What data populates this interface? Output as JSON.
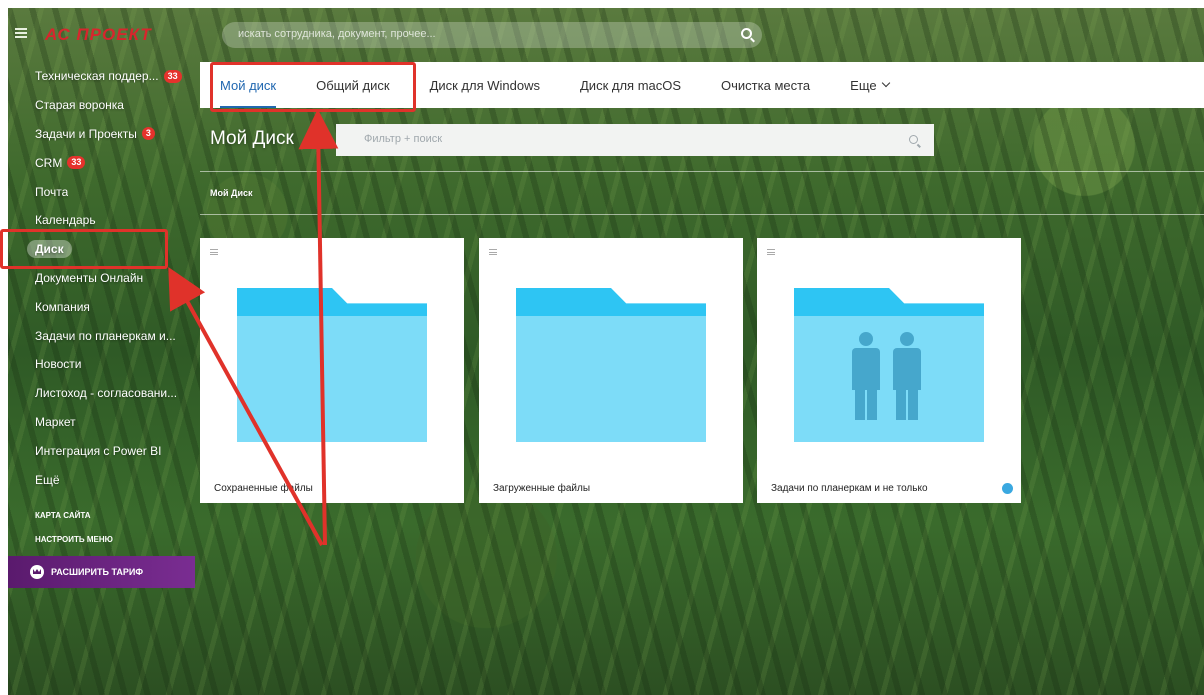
{
  "header": {
    "logo_text": "АС ПРОЕКТ",
    "search_placeholder": "искать сотрудника, документ, прочее..."
  },
  "sidebar": {
    "items": [
      {
        "label": "Техническая поддер...",
        "badge": "33"
      },
      {
        "label": "Старая воронка",
        "badge": null
      },
      {
        "label": "Задачи и Проекты",
        "badge": "3"
      },
      {
        "label": "CRM",
        "badge": "33"
      },
      {
        "label": "Почта",
        "badge": null
      },
      {
        "label": "Календарь",
        "badge": null
      },
      {
        "label": "Диск",
        "badge": null
      },
      {
        "label": "Документы Онлайн",
        "badge": null
      },
      {
        "label": "Компания",
        "badge": null
      },
      {
        "label": "Задачи по планеркам и...",
        "badge": null
      },
      {
        "label": "Новости",
        "badge": null
      },
      {
        "label": "Листоход - согласовани...",
        "badge": null
      },
      {
        "label": "Маркет",
        "badge": null
      },
      {
        "label": "Интеграция с Power BI",
        "badge": null
      },
      {
        "label": "Ещё",
        "badge": null
      }
    ],
    "active_index": 6,
    "sitemap_label": "КАРТА САЙТА",
    "configure_label": "НАСТРОИТЬ МЕНЮ",
    "upgrade_label": "РАСШИРИТЬ ТАРИФ"
  },
  "tabs": [
    {
      "label": "Мой диск",
      "active": true
    },
    {
      "label": "Общий диск",
      "active": false
    },
    {
      "label": "Диск для Windows",
      "active": false
    },
    {
      "label": "Диск для macOS",
      "active": false
    },
    {
      "label": "Очистка места",
      "active": false
    },
    {
      "label": "Еще",
      "active": false
    }
  ],
  "page": {
    "title": "Мой Диск",
    "filter_placeholder": "Фильтр + поиск",
    "breadcrumb": "Мой Диск"
  },
  "folders": [
    {
      "label": "Сохраненные файлы",
      "shared": false
    },
    {
      "label": "Загруженные файлы",
      "shared": false
    },
    {
      "label": "Задачи по планеркам и не только",
      "shared": true
    }
  ],
  "colors": {
    "accent": "#2067b0",
    "badge": "#e5322c",
    "annotation": "#e0322a",
    "folder_tab": "#2ec5f3",
    "folder_body": "#7ddcf8",
    "upgrade_bg": "#6a2380"
  }
}
